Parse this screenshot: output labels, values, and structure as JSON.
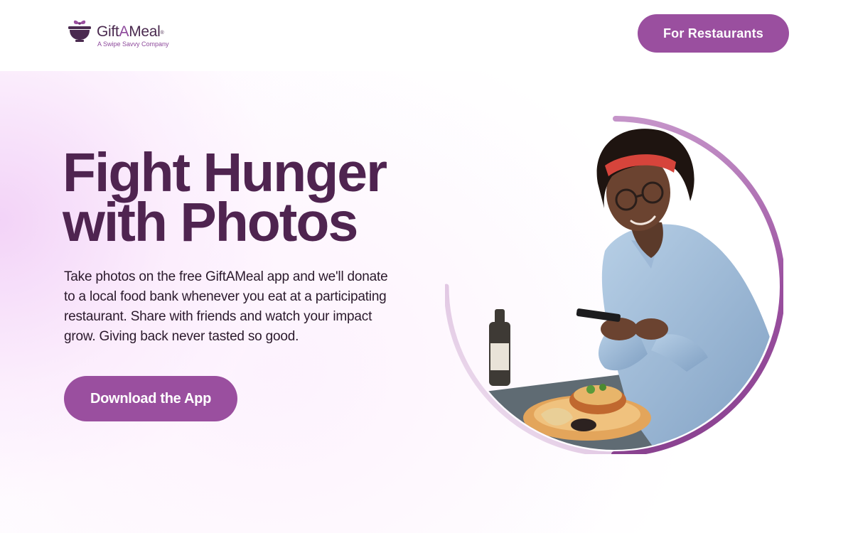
{
  "header": {
    "logo": {
      "brand_prefix": "Gift",
      "brand_accent": "A",
      "brand_suffix": "Meal",
      "registered": "®",
      "tagline": "A Swipe Savvy Company",
      "icon": "bowl-with-bow-icon"
    },
    "cta_label": "For Restaurants"
  },
  "hero": {
    "title_line1": "Fight Hunger",
    "title_line2": "with Photos",
    "description": "Take photos on the free GiftAMeal app and we'll donate to a local food bank whenever you eat at a participating restaurant. Share with friends and watch your impact grow. Giving back never tasted so good.",
    "cta_label": "Download the App",
    "image_subject": "woman-photographing-meal-image"
  },
  "colors": {
    "brand_purple": "#9a4f9f",
    "title_plum": "#4f2450",
    "hero_tint": "#f3d3f7"
  }
}
